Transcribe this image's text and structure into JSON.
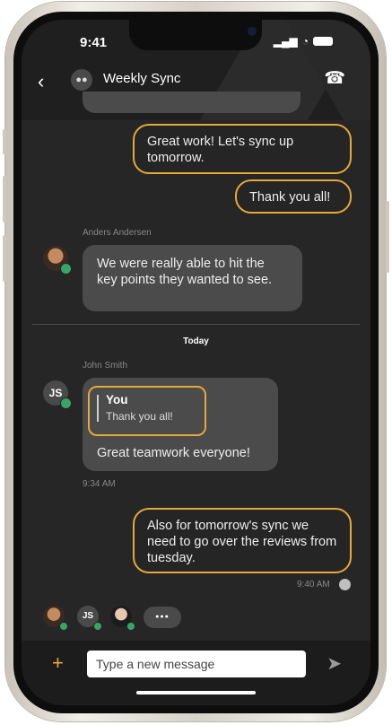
{
  "status_bar": {
    "time": "9:41",
    "signal": "▂▄▆",
    "wifi": "◔"
  },
  "header": {
    "back_glyph": "‹",
    "group_glyph": "●●",
    "title": "Weekly Sync",
    "call_glyph": "☎"
  },
  "messages": [
    {
      "type": "outgoing",
      "text": "Great work! Let's sync up tomorrow."
    },
    {
      "type": "outgoing",
      "text": "Thank you all!"
    },
    {
      "type": "incoming",
      "sender": "Anders Andersen",
      "text": "We were really able to hit the key points they wanted to see."
    }
  ],
  "divider_label": "Today",
  "reply_message": {
    "sender": "John Smith",
    "avatar_initials": "JS",
    "quote_author": "You",
    "quote_text": "Thank you all!",
    "text": "Great teamwork everyone!",
    "time": "9:34 AM"
  },
  "last_outgoing": {
    "text": "Also for tomorrow's sync we need to go over the reviews from tuesday.",
    "time": "9:40 AM"
  },
  "readers": {
    "initials": "JS",
    "more": "●●●"
  },
  "composer": {
    "plus": "+",
    "placeholder": "Type a new message",
    "send": "➤"
  },
  "colors": {
    "accent": "#e8a73a",
    "presence": "#36a566",
    "background": "#262626"
  }
}
